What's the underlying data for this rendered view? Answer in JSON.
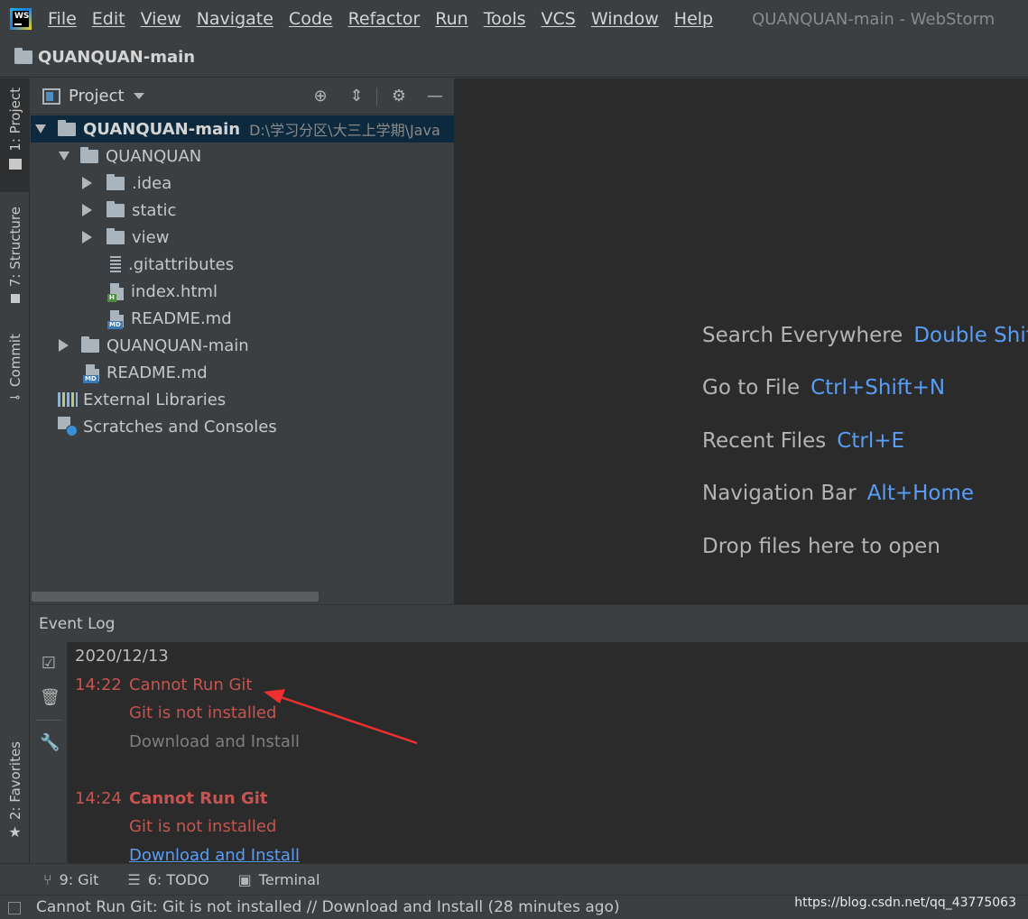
{
  "app": {
    "logo_text": "WS",
    "window_title": "QUANQUAN-main - WebStorm"
  },
  "menu": [
    "File",
    "Edit",
    "View",
    "Navigate",
    "Code",
    "Refactor",
    "Run",
    "Tools",
    "VCS",
    "Window",
    "Help"
  ],
  "navbar": {
    "project": "QUANQUAN-main"
  },
  "left_strip": {
    "project_tab": "1: Project",
    "structure_tab": "7: Structure",
    "commit_tab": "Commit",
    "favorites_tab": "2: Favorites"
  },
  "project_panel": {
    "title": "Project",
    "tree": [
      {
        "name": "QUANQUAN-main",
        "path": "D:\\学习分区\\大三上学期\\Java",
        "level": 0,
        "type": "folder",
        "expanded": true,
        "selected": true
      },
      {
        "name": "QUANQUAN",
        "level": 1,
        "type": "folder",
        "expanded": true
      },
      {
        "name": ".idea",
        "level": 2,
        "type": "folder",
        "expanded": false
      },
      {
        "name": "static",
        "level": 2,
        "type": "folder",
        "expanded": false
      },
      {
        "name": "view",
        "level": 2,
        "type": "folder",
        "expanded": false
      },
      {
        "name": ".gitattributes",
        "level": 2,
        "type": "text-file"
      },
      {
        "name": "index.html",
        "level": 2,
        "type": "html-file"
      },
      {
        "name": "README.md",
        "level": 2,
        "type": "md-file"
      },
      {
        "name": "QUANQUAN-main",
        "level": 1,
        "type": "folder",
        "expanded": false
      },
      {
        "name": "README.md",
        "level": 1,
        "type": "md-file"
      },
      {
        "name": "External Libraries",
        "level": 0,
        "type": "libraries"
      },
      {
        "name": "Scratches and Consoles",
        "level": 0,
        "type": "scratches"
      }
    ]
  },
  "editor_hints": [
    {
      "label": "Search Everywhere",
      "key": "Double Shif"
    },
    {
      "label": "Go to File",
      "key": "Ctrl+Shift+N"
    },
    {
      "label": "Recent Files",
      "key": "Ctrl+E"
    },
    {
      "label": "Navigation Bar",
      "key": "Alt+Home"
    },
    {
      "label": "Drop files here to open",
      "key": ""
    }
  ],
  "event_log": {
    "title": "Event Log",
    "date": "2020/12/13",
    "entries": [
      {
        "time": "14:22",
        "title": "Cannot Run Git",
        "message": "Git is not installed",
        "action": "Download and Install"
      },
      {
        "time": "14:24",
        "title": "Cannot Run Git",
        "message": "Git is not installed",
        "action": "Download and Install"
      }
    ]
  },
  "tool_tabs": {
    "git": "9: Git",
    "todo": "6: TODO",
    "terminal": "Terminal"
  },
  "status_bar": {
    "message": "Cannot Run Git: Git is not installed // Download and Install (28 minutes ago)",
    "watermark": "https://blog.csdn.net/qq_43775063"
  },
  "colors": {
    "error": "#c75450",
    "link": "#589df6",
    "annotation_arrow": "#f0302e"
  }
}
